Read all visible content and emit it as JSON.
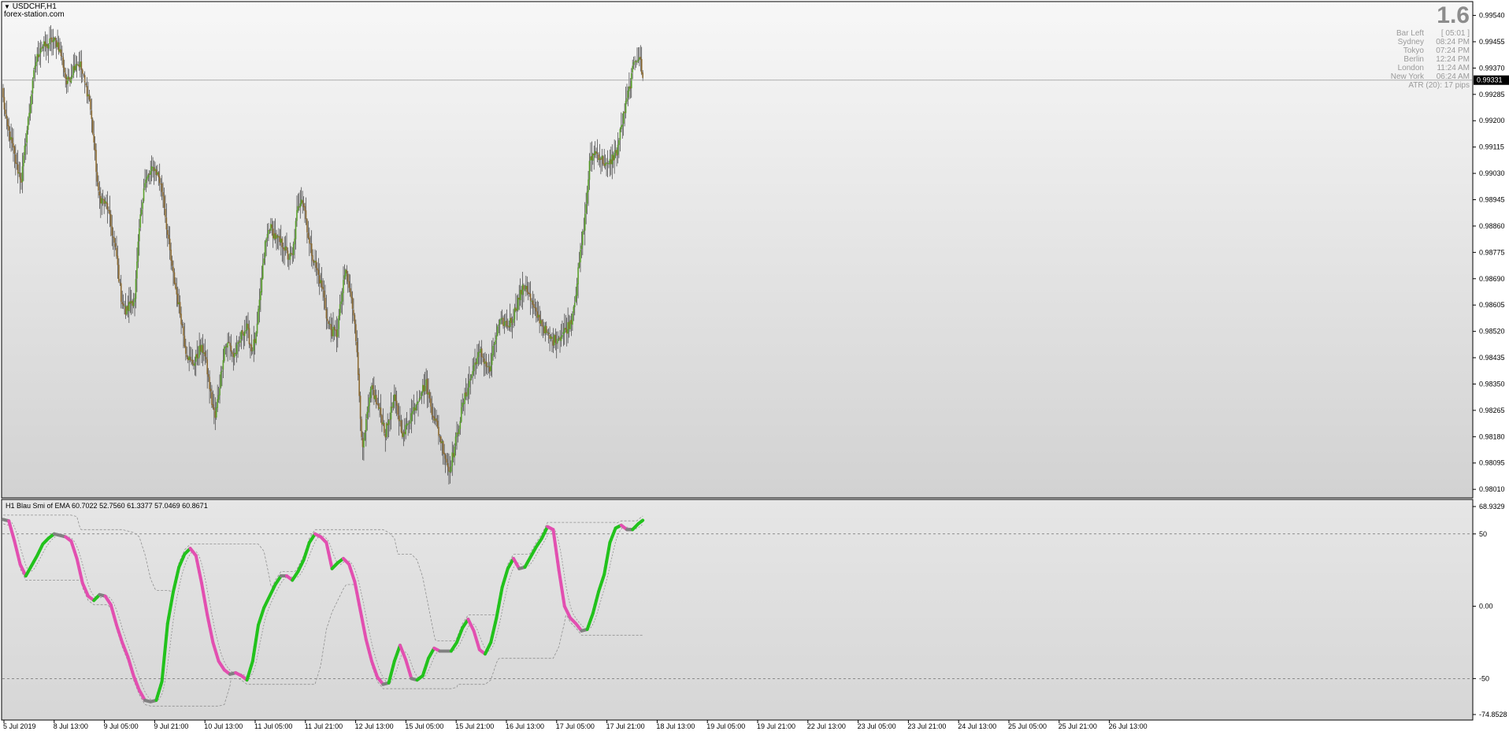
{
  "window": {
    "symbol_title": "USDCHF,H1",
    "watermark": "forex-station.com",
    "dropdown_icon": "triangle-down-icon"
  },
  "info": {
    "spread": "1.6",
    "rows": [
      {
        "label": "Bar Left",
        "value": "[ 05:01 ]"
      },
      {
        "label": "Sydney",
        "value": "08:24 PM"
      },
      {
        "label": "Tokyo",
        "value": "07:24 PM"
      },
      {
        "label": "Berlin",
        "value": "12:24 PM"
      },
      {
        "label": "London",
        "value": "11:24 AM"
      },
      {
        "label": "New York",
        "value": "06:24 AM"
      }
    ],
    "atr": "ATR (20): 17 pips"
  },
  "indicator": {
    "label": "H1 Blau Smi of EMA 60.7022 52.7560 61.3377 57.0469 60.8671"
  },
  "colors": {
    "background_top": "#f7f7f7",
    "background_bottom": "#d4d4d4",
    "bull_candle": "#5aa02c",
    "bear_candle": "#8b6a32",
    "wick": "#3d3d3d",
    "smi_up": "#22c21c",
    "smi_down": "#e24fb0",
    "smi_neutral": "#808080",
    "band": "#909090",
    "current_price_bg": "#000000"
  },
  "chart_data": [
    {
      "type": "candlestick",
      "title": "USDCHF,H1",
      "y_ticks": [
        "0.99540",
        "0.99455",
        "0.99370",
        "0.99285",
        "0.99200",
        "0.99115",
        "0.99030",
        "0.98945",
        "0.98860",
        "0.98775",
        "0.98690",
        "0.98605",
        "0.98520",
        "0.98435",
        "0.98350",
        "0.98265",
        "0.98180",
        "0.98095",
        "0.98010"
      ],
      "ylim": [
        0.97985,
        0.99577
      ],
      "current_price": "0.99331",
      "current_price_value": 0.99331,
      "x_tick_labels": [
        "5 Jul 2019",
        "8 Jul 13:00",
        "9 Jul 05:00",
        "9 Jul 21:00",
        "10 Jul 13:00",
        "11 Jul 05:00",
        "11 Jul 21:00",
        "12 Jul 13:00",
        "15 Jul 05:00",
        "15 Jul 21:00",
        "16 Jul 13:00",
        "17 Jul 05:00",
        "17 Jul 21:00",
        "18 Jul 13:00",
        "19 Jul 05:00",
        "19 Jul 21:00",
        "22 Jul 13:00",
        "23 Jul 05:00",
        "23 Jul 21:00",
        "24 Jul 13:00",
        "25 Jul 05:00",
        "25 Jul 21:00",
        "26 Jul 13:00"
      ],
      "close_anchors": [
        [
          0,
          0.9927
        ],
        [
          3,
          0.9919
        ],
        [
          8,
          0.9912
        ],
        [
          12,
          0.9905
        ],
        [
          16,
          0.9901
        ],
        [
          20,
          0.9914
        ],
        [
          24,
          0.9926
        ],
        [
          28,
          0.9938
        ],
        [
          33,
          0.9944
        ],
        [
          38,
          0.9944
        ],
        [
          43,
          0.9946
        ],
        [
          48,
          0.9945
        ],
        [
          52,
          0.994
        ],
        [
          56,
          0.9932
        ],
        [
          60,
          0.9935
        ],
        [
          64,
          0.9939
        ],
        [
          68,
          0.9938
        ],
        [
          72,
          0.9932
        ],
        [
          76,
          0.9927
        ],
        [
          80,
          0.9913
        ],
        [
          84,
          0.9896
        ],
        [
          88,
          0.9894
        ],
        [
          92,
          0.9892
        ],
        [
          96,
          0.9884
        ],
        [
          100,
          0.9876
        ],
        [
          104,
          0.9863
        ],
        [
          108,
          0.9858
        ],
        [
          113,
          0.9862
        ],
        [
          116,
          0.9862
        ],
        [
          120,
          0.9885
        ],
        [
          124,
          0.9899
        ],
        [
          128,
          0.9902
        ],
        [
          133,
          0.9905
        ],
        [
          137,
          0.9902
        ],
        [
          141,
          0.9896
        ],
        [
          145,
          0.9883
        ],
        [
          149,
          0.9872
        ],
        [
          153,
          0.9864
        ],
        [
          157,
          0.9856
        ],
        [
          161,
          0.9846
        ],
        [
          165,
          0.9842
        ],
        [
          169,
          0.9842
        ],
        [
          173,
          0.9846
        ],
        [
          177,
          0.9846
        ],
        [
          180,
          0.9839
        ],
        [
          184,
          0.9829
        ],
        [
          187,
          0.9824
        ],
        [
          191,
          0.9835
        ],
        [
          195,
          0.9847
        ],
        [
          199,
          0.9848
        ],
        [
          203,
          0.9844
        ],
        [
          207,
          0.9847
        ],
        [
          211,
          0.9852
        ],
        [
          215,
          0.9853
        ],
        [
          219,
          0.9846
        ],
        [
          223,
          0.985
        ],
        [
          227,
          0.9865
        ],
        [
          231,
          0.988
        ],
        [
          235,
          0.9886
        ],
        [
          239,
          0.9883
        ],
        [
          243,
          0.9881
        ],
        [
          247,
          0.988
        ],
        [
          251,
          0.9876
        ],
        [
          255,
          0.9876
        ],
        [
          259,
          0.989
        ],
        [
          263,
          0.9896
        ],
        [
          266,
          0.9891
        ],
        [
          270,
          0.988
        ],
        [
          274,
          0.9875
        ],
        [
          278,
          0.987
        ],
        [
          282,
          0.9865
        ],
        [
          286,
          0.9855
        ],
        [
          290,
          0.9852
        ],
        [
          294,
          0.9851
        ],
        [
          298,
          0.9862
        ],
        [
          302,
          0.9872
        ],
        [
          306,
          0.9864
        ],
        [
          310,
          0.9856
        ],
        [
          313,
          0.9838
        ],
        [
          317,
          0.9813
        ],
        [
          321,
          0.9825
        ],
        [
          325,
          0.9834
        ],
        [
          329,
          0.9829
        ],
        [
          333,
          0.9825
        ],
        [
          337,
          0.9819
        ],
        [
          341,
          0.9825
        ],
        [
          345,
          0.983
        ],
        [
          349,
          0.9824
        ],
        [
          353,
          0.9818
        ],
        [
          357,
          0.9823
        ],
        [
          361,
          0.9826
        ],
        [
          365,
          0.983
        ],
        [
          369,
          0.9833
        ],
        [
          373,
          0.9835
        ],
        [
          377,
          0.9828
        ],
        [
          381,
          0.9823
        ],
        [
          385,
          0.9818
        ],
        [
          389,
          0.9813
        ],
        [
          393,
          0.9807
        ],
        [
          397,
          0.9813
        ],
        [
          401,
          0.982
        ],
        [
          405,
          0.9828
        ],
        [
          409,
          0.9833
        ],
        [
          413,
          0.9838
        ],
        [
          417,
          0.9843
        ],
        [
          421,
          0.9845
        ],
        [
          425,
          0.9842
        ],
        [
          429,
          0.9839
        ],
        [
          433,
          0.9848
        ],
        [
          437,
          0.9854
        ],
        [
          441,
          0.9855
        ],
        [
          445,
          0.9854
        ],
        [
          449,
          0.9856
        ],
        [
          453,
          0.9861
        ],
        [
          457,
          0.9865
        ],
        [
          461,
          0.9867
        ],
        [
          465,
          0.9862
        ],
        [
          469,
          0.9858
        ],
        [
          473,
          0.9856
        ],
        [
          477,
          0.9853
        ],
        [
          481,
          0.985
        ],
        [
          485,
          0.9849
        ],
        [
          489,
          0.985
        ],
        [
          493,
          0.9851
        ],
        [
          497,
          0.9853
        ],
        [
          501,
          0.9856
        ],
        [
          505,
          0.9865
        ],
        [
          509,
          0.9877
        ],
        [
          513,
          0.9889
        ],
        [
          517,
          0.9906
        ],
        [
          521,
          0.991
        ],
        [
          525,
          0.9909
        ],
        [
          529,
          0.9907
        ],
        [
          533,
          0.9905
        ],
        [
          537,
          0.9908
        ],
        [
          541,
          0.991
        ],
        [
          545,
          0.9918
        ],
        [
          549,
          0.9925
        ],
        [
          553,
          0.9932
        ],
        [
          557,
          0.994
        ],
        [
          561,
          0.9941
        ],
        [
          564,
          0.99331
        ]
      ]
    },
    {
      "type": "line",
      "title": "H1 Blau Smi of EMA 60.7022 52.7560 61.3377 57.0469 60.8671",
      "y_ticks": [
        "68.9329",
        "50",
        "0.00",
        "-50",
        "-74.8528"
      ],
      "ylim": [
        -74.8528,
        68.9329
      ],
      "levels": [
        50,
        -50
      ],
      "series": [
        {
          "name": "SMI",
          "anchors": [
            [
              0,
              60
            ],
            [
              5,
              59
            ],
            [
              10,
              45
            ],
            [
              15,
              29
            ],
            [
              20,
              21
            ],
            [
              25,
              28
            ],
            [
              30,
              35
            ],
            [
              35,
              43
            ],
            [
              40,
              47
            ],
            [
              45,
              50
            ],
            [
              50,
              49
            ],
            [
              55,
              48
            ],
            [
              60,
              45
            ],
            [
              65,
              33
            ],
            [
              70,
              16
            ],
            [
              75,
              7
            ],
            [
              80,
              4
            ],
            [
              85,
              8
            ],
            [
              90,
              7
            ],
            [
              95,
              1
            ],
            [
              100,
              -13
            ],
            [
              105,
              -25
            ],
            [
              110,
              -35
            ],
            [
              115,
              -48
            ],
            [
              120,
              -58
            ],
            [
              125,
              -65
            ],
            [
              130,
              -66
            ],
            [
              135,
              -65
            ],
            [
              140,
              -52
            ],
            [
              145,
              -12
            ],
            [
              150,
              10
            ],
            [
              155,
              27
            ],
            [
              160,
              36
            ],
            [
              165,
              40
            ],
            [
              170,
              35
            ],
            [
              175,
              16
            ],
            [
              180,
              -6
            ],
            [
              185,
              -25
            ],
            [
              190,
              -38
            ],
            [
              195,
              -44
            ],
            [
              200,
              -47
            ],
            [
              205,
              -46
            ],
            [
              210,
              -48
            ],
            [
              215,
              -51
            ],
            [
              220,
              -38
            ],
            [
              225,
              -13
            ],
            [
              230,
              -1
            ],
            [
              235,
              7
            ],
            [
              240,
              15
            ],
            [
              245,
              21
            ],
            [
              250,
              21
            ],
            [
              255,
              18
            ],
            [
              260,
              24
            ],
            [
              265,
              32
            ],
            [
              270,
              44
            ],
            [
              275,
              50
            ],
            [
              280,
              48
            ],
            [
              285,
              44
            ],
            [
              290,
              26
            ],
            [
              295,
              30
            ],
            [
              300,
              33
            ],
            [
              305,
              29
            ],
            [
              310,
              17
            ],
            [
              315,
              -3
            ],
            [
              320,
              -23
            ],
            [
              325,
              -38
            ],
            [
              330,
              -49
            ],
            [
              335,
              -54
            ],
            [
              340,
              -53
            ],
            [
              345,
              -38
            ],
            [
              350,
              -27
            ],
            [
              355,
              -37
            ],
            [
              360,
              -50
            ],
            [
              365,
              -51
            ],
            [
              370,
              -48
            ],
            [
              375,
              -36
            ],
            [
              380,
              -29
            ],
            [
              385,
              -31
            ],
            [
              390,
              -31
            ],
            [
              395,
              -31
            ],
            [
              400,
              -25
            ],
            [
              405,
              -15
            ],
            [
              410,
              -9
            ],
            [
              415,
              -17
            ],
            [
              420,
              -30
            ],
            [
              425,
              -33
            ],
            [
              430,
              -25
            ],
            [
              435,
              -8
            ],
            [
              440,
              13
            ],
            [
              445,
              26
            ],
            [
              450,
              33
            ],
            [
              455,
              26
            ],
            [
              460,
              27
            ],
            [
              465,
              34
            ],
            [
              470,
              41
            ],
            [
              475,
              47
            ],
            [
              480,
              55
            ],
            [
              485,
              53
            ],
            [
              490,
              25
            ],
            [
              495,
              0
            ],
            [
              500,
              -8
            ],
            [
              505,
              -12
            ],
            [
              510,
              -17
            ],
            [
              515,
              -16
            ],
            [
              520,
              -5
            ],
            [
              525,
              10
            ],
            [
              530,
              22
            ],
            [
              535,
              44
            ],
            [
              540,
              54
            ],
            [
              545,
              56
            ],
            [
              550,
              53
            ],
            [
              555,
              53
            ],
            [
              560,
              57
            ],
            [
              565,
              60
            ]
          ]
        }
      ]
    }
  ]
}
